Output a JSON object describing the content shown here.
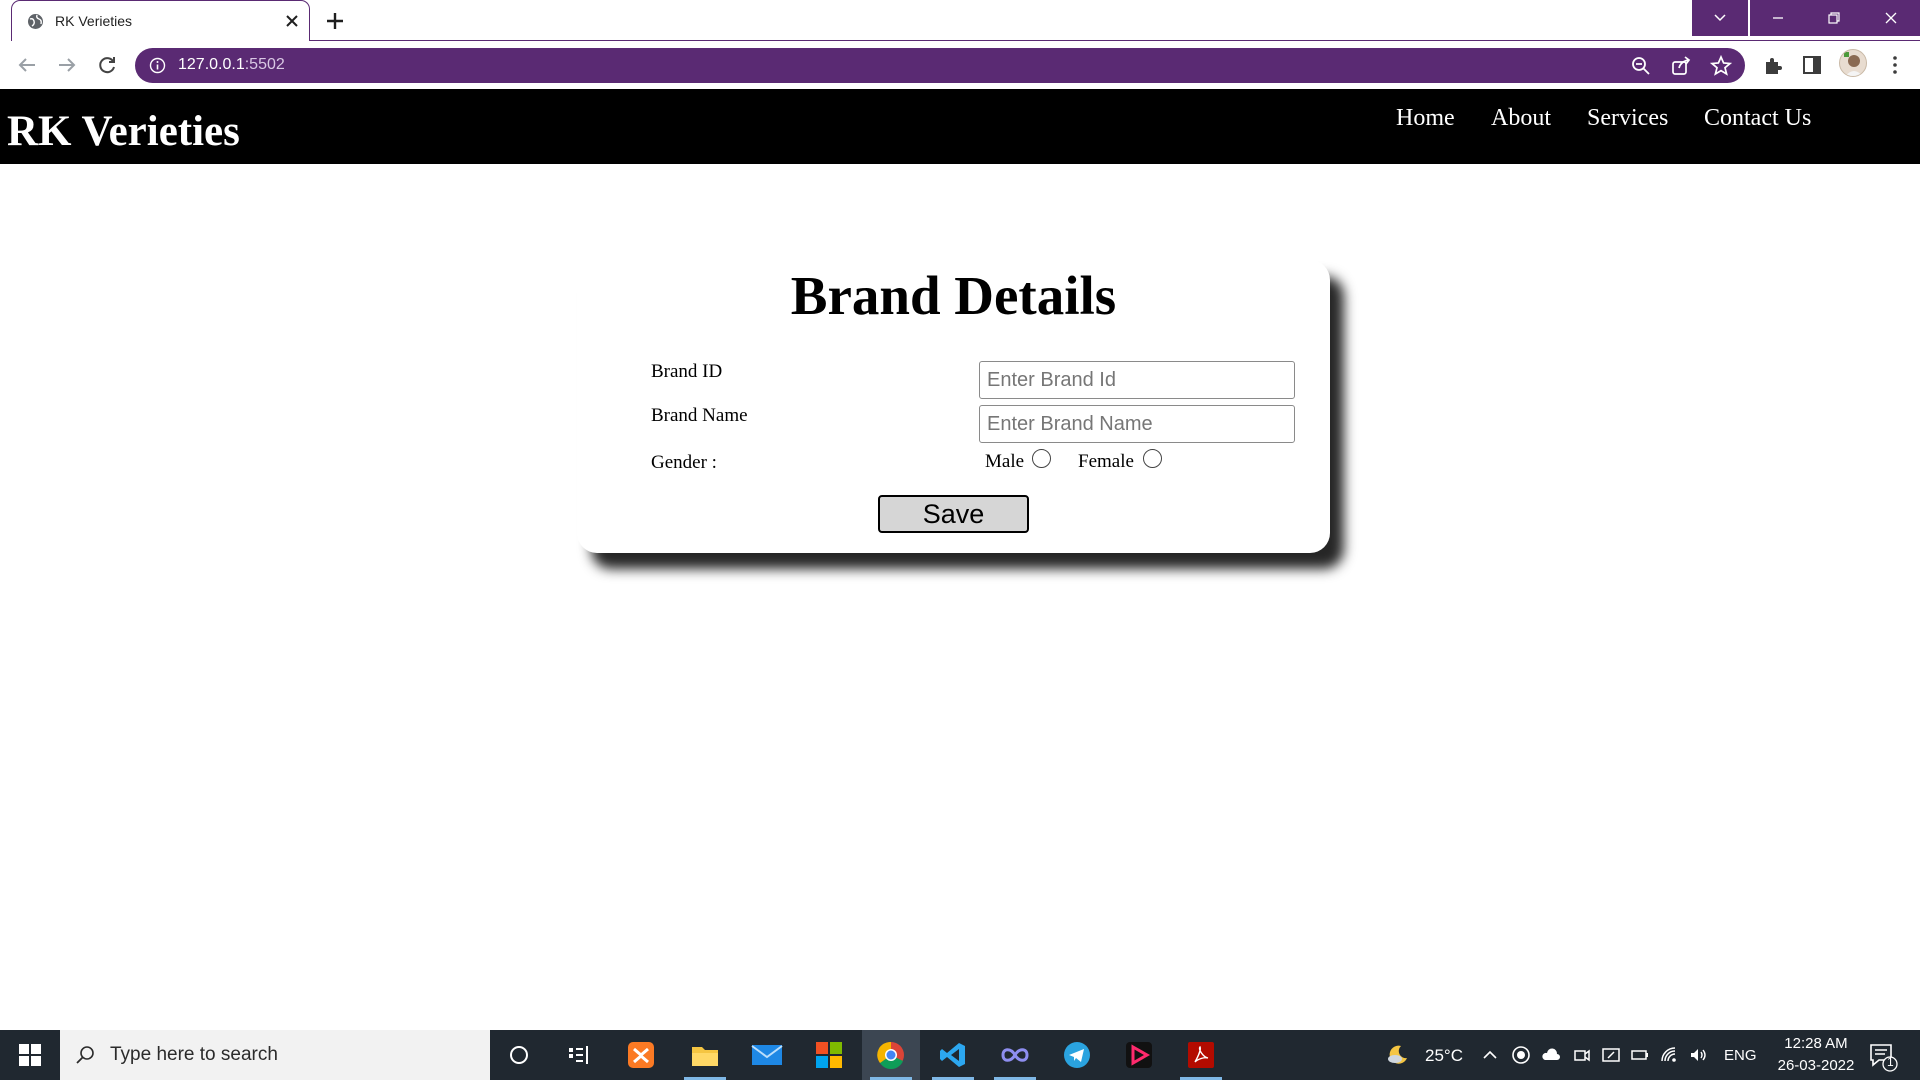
{
  "browser": {
    "tab": {
      "title": "RK Verieties"
    },
    "address": {
      "host": "127.0.0.1",
      "port": ":5502"
    },
    "accent_color": "#5a2a73"
  },
  "site": {
    "logo": "RK Verieties",
    "nav": [
      "Home",
      "About",
      "Services",
      "Contact Us"
    ]
  },
  "form": {
    "title": "Brand Details",
    "brand_id": {
      "label": "Brand ID",
      "placeholder": "Enter Brand Id",
      "value": ""
    },
    "brand_name": {
      "label": "Brand Name",
      "placeholder": "Enter Brand Name",
      "value": ""
    },
    "gender": {
      "label": "Gender :",
      "options": [
        "Male",
        "Female"
      ],
      "selected": null
    },
    "save_label": "Save"
  },
  "taskbar": {
    "search_placeholder": "Type here to search",
    "weather": "25°C",
    "language": "ENG",
    "time": "12:28 AM",
    "date": "26-03-2022",
    "notification_count": "1"
  }
}
